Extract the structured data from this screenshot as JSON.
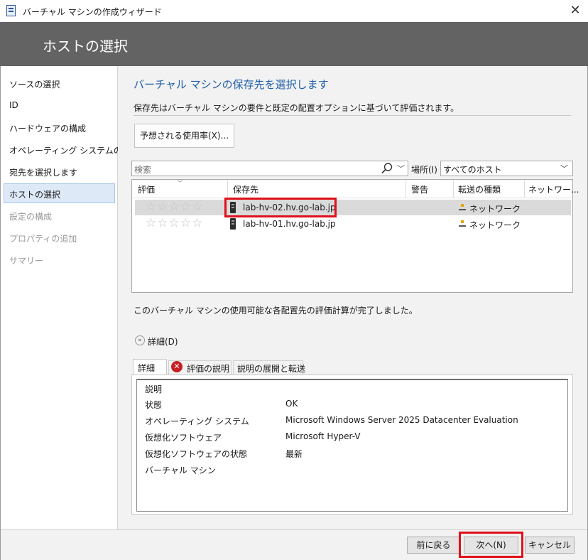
{
  "window": {
    "title": "バーチャル マシンの作成ウィザード"
  },
  "page": {
    "title": "ホストの選択"
  },
  "sidebar": {
    "items": [
      {
        "label": "ソースの選択"
      },
      {
        "label": "ID"
      },
      {
        "label": "ハードウェアの構成"
      },
      {
        "label": "オペレーティング システムの構成"
      },
      {
        "label": "宛先を選択します"
      },
      {
        "label": "ホストの選択",
        "selected": true
      },
      {
        "label": "設定の構成",
        "disabled": true
      },
      {
        "label": "プロパティの追加",
        "disabled": true
      },
      {
        "label": "サマリー",
        "disabled": true
      }
    ]
  },
  "main": {
    "heading": "バーチャル マシンの保存先を選択します",
    "description": "保存先はバーチャル マシンの要件と既定の配置オプションに基づいて評価されます。",
    "usage_button": "予想される使用率(X)...",
    "search": {
      "placeholder": "検索"
    },
    "location": {
      "label": "場所(I)",
      "value": "すべてのホスト"
    },
    "grid": {
      "columns": [
        "評価",
        "保存先",
        "警告",
        "転送の種類",
        "ネットワー..."
      ],
      "rows": [
        {
          "rating": "☆☆☆☆☆",
          "destination": "lab-hv-02.hv.go-lab.jp",
          "warning": "",
          "transfer": "ネットワーク",
          "selected": true
        },
        {
          "rating": "☆☆☆☆☆",
          "destination": "lab-hv-01.hv.go-lab.jp",
          "warning": "",
          "transfer": "ネットワーク"
        }
      ]
    },
    "status_message": "このバーチャル マシンの使用可能な各配置先の評価計算が完了しました。",
    "details_toggle": "詳細(D)",
    "tabs": [
      "詳細",
      "評価の説明",
      "説明の展開と転送"
    ],
    "details": [
      {
        "key": "説明",
        "value": ""
      },
      {
        "key": "状態",
        "value": "OK"
      },
      {
        "key": "オペレーティング システム",
        "value": "Microsoft Windows Server 2025 Datacenter Evaluation"
      },
      {
        "key": "仮想化ソフトウェア",
        "value": "Microsoft Hyper-V"
      },
      {
        "key": "仮想化ソフトウェアの状態",
        "value": "最新"
      },
      {
        "key": "バーチャル マシン",
        "value": ""
      }
    ]
  },
  "footer": {
    "back": "前に戻る",
    "next": "次へ(N)",
    "cancel": "キャンセル"
  },
  "colors": {
    "header_band": "#636363",
    "accent": "#1f5fa8",
    "highlight_box": "#e0101a",
    "error": "#c81f24"
  },
  "icons": [
    "app-icon",
    "close-icon",
    "search-icon",
    "chevron-down-icon",
    "server-icon",
    "network-icon",
    "error-icon",
    "expand-icon"
  ]
}
